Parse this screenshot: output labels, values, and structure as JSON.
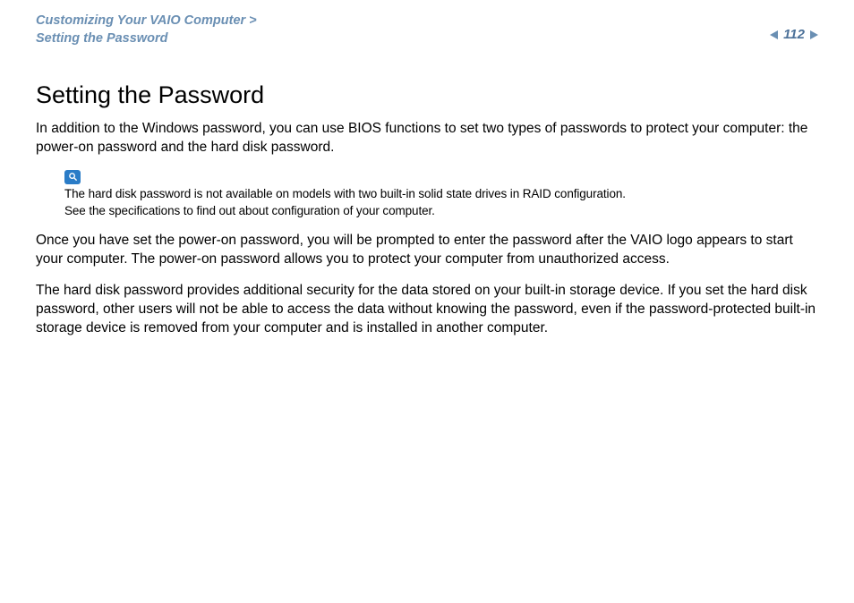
{
  "header": {
    "breadcrumb_line1": "Customizing Your VAIO Computer >",
    "breadcrumb_line2": "Setting the Password",
    "page_number": "112"
  },
  "content": {
    "title": "Setting the Password",
    "intro": "In addition to the Windows password, you can use BIOS functions to set two types of passwords to protect your computer: the power-on password and the hard disk password.",
    "note_line1": "The hard disk password is not available on models with two built-in solid state drives in RAID configuration.",
    "note_line2": "See the specifications to find out about configuration of your computer.",
    "para2": "Once you have set the power-on password, you will be prompted to enter the password after the VAIO logo appears to start your computer. The power-on password allows you to protect your computer from unauthorized access.",
    "para3": "The hard disk password provides additional security for the data stored on your built-in storage device. If you set the hard disk password, other users will not be able to access the data without knowing the password, even if the password-protected built-in storage device is removed from your computer and is installed in another computer."
  }
}
